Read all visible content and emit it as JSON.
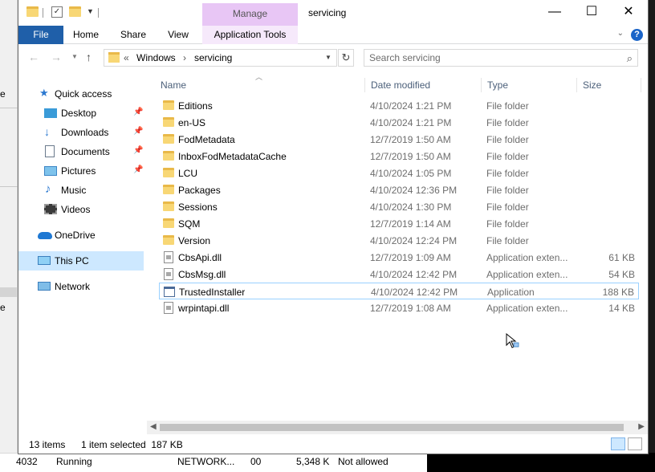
{
  "background": {
    "left_stubs": [
      "e",
      "e"
    ],
    "process_row": {
      "pid": "4032",
      "status": "Running",
      "user": "NETWORK...",
      "session": "00",
      "memory": "5,348 K",
      "uac": "Not allowed"
    }
  },
  "window": {
    "title": "servicing",
    "contextual_tab_group": "Manage",
    "controls": {
      "minimize": "—",
      "maximize": "☐",
      "close": "✕"
    }
  },
  "ribbon": {
    "tabs": [
      "File",
      "Home",
      "Share",
      "View",
      "Application Tools"
    ],
    "help": "?",
    "expand": "⌄"
  },
  "address": {
    "overflow": "«",
    "crumbs": [
      "Windows",
      "servicing"
    ],
    "separator": "›",
    "search_placeholder": "Search servicing"
  },
  "nav": {
    "quick_access": "Quick access",
    "pinned": [
      "Desktop",
      "Downloads",
      "Documents",
      "Pictures"
    ],
    "unpinned": [
      "Music",
      "Videos"
    ],
    "onedrive": "OneDrive",
    "this_pc": "This PC",
    "network": "Network"
  },
  "columns": {
    "name": "Name",
    "date": "Date modified",
    "type": "Type",
    "size": "Size"
  },
  "files": [
    {
      "name": "Editions",
      "date": "4/10/2024 1:21 PM",
      "type": "File folder",
      "size": "",
      "icon": "folder"
    },
    {
      "name": "en-US",
      "date": "4/10/2024 1:21 PM",
      "type": "File folder",
      "size": "",
      "icon": "folder"
    },
    {
      "name": "FodMetadata",
      "date": "12/7/2019 1:50 AM",
      "type": "File folder",
      "size": "",
      "icon": "folder"
    },
    {
      "name": "InboxFodMetadataCache",
      "date": "12/7/2019 1:50 AM",
      "type": "File folder",
      "size": "",
      "icon": "folder"
    },
    {
      "name": "LCU",
      "date": "4/10/2024 1:05 PM",
      "type": "File folder",
      "size": "",
      "icon": "folder"
    },
    {
      "name": "Packages",
      "date": "4/10/2024 12:36 PM",
      "type": "File folder",
      "size": "",
      "icon": "folder"
    },
    {
      "name": "Sessions",
      "date": "4/10/2024 1:30 PM",
      "type": "File folder",
      "size": "",
      "icon": "folder"
    },
    {
      "name": "SQM",
      "date": "12/7/2019 1:14 AM",
      "type": "File folder",
      "size": "",
      "icon": "folder"
    },
    {
      "name": "Version",
      "date": "4/10/2024 12:24 PM",
      "type": "File folder",
      "size": "",
      "icon": "folder"
    },
    {
      "name": "CbsApi.dll",
      "date": "12/7/2019 1:09 AM",
      "type": "Application exten...",
      "size": "61 KB",
      "icon": "dll"
    },
    {
      "name": "CbsMsg.dll",
      "date": "4/10/2024 12:42 PM",
      "type": "Application exten...",
      "size": "54 KB",
      "icon": "dll"
    },
    {
      "name": "TrustedInstaller",
      "date": "4/10/2024 12:42 PM",
      "type": "Application",
      "size": "188 KB",
      "icon": "exe"
    },
    {
      "name": "wrpintapi.dll",
      "date": "12/7/2019 1:08 AM",
      "type": "Application exten...",
      "size": "14 KB",
      "icon": "dll"
    }
  ],
  "selected_index": 11,
  "status": {
    "item_count": "13 items",
    "selection": "1 item selected  187 KB"
  }
}
